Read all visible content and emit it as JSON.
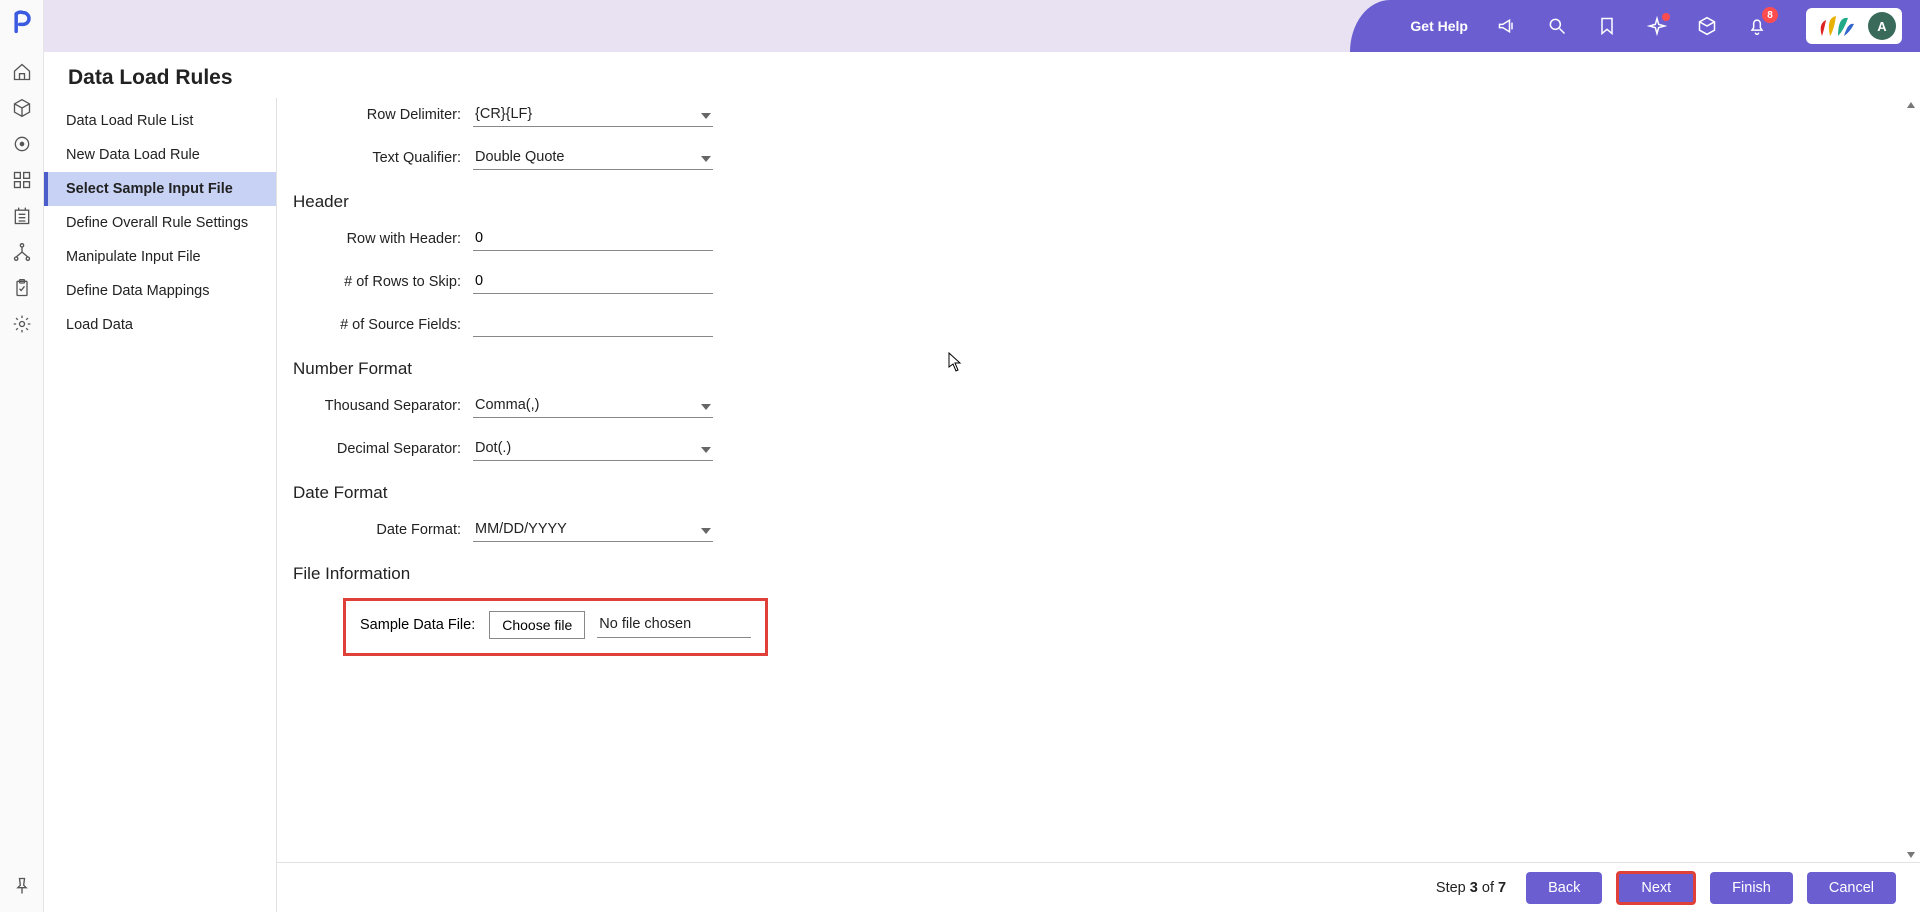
{
  "header": {
    "get_help": "Get Help",
    "badge_count": "8",
    "avatar_initial": "A"
  },
  "page_title": "Data Load Rules",
  "wizard": {
    "items": [
      "Data Load Rule List",
      "New Data Load Rule",
      "Select Sample Input File",
      "Define Overall Rule Settings",
      "Manipulate Input File",
      "Define Data Mappings",
      "Load Data"
    ],
    "active_index": 2
  },
  "form": {
    "row_delimiter_label": "Row Delimiter:",
    "row_delimiter_value": "{CR}{LF}",
    "text_qualifier_label": "Text Qualifier:",
    "text_qualifier_value": "Double Quote",
    "header_section": "Header",
    "row_with_header_label": "Row with Header:",
    "row_with_header_value": "0",
    "rows_to_skip_label": "# of Rows to Skip:",
    "rows_to_skip_value": "0",
    "source_fields_label": "# of Source Fields:",
    "source_fields_value": "",
    "number_section": "Number Format",
    "thousand_sep_label": "Thousand Separator:",
    "thousand_sep_value": "Comma(,)",
    "decimal_sep_label": "Decimal Separator:",
    "decimal_sep_value": "Dot(.)",
    "date_section": "Date Format",
    "date_format_label": "Date Format:",
    "date_format_value": "MM/DD/YYYY",
    "file_section": "File Information",
    "sample_file_label": "Sample Data File:",
    "choose_file_btn": "Choose file",
    "file_status": "No file chosen"
  },
  "footer": {
    "step_word": "Step",
    "step_current": "3",
    "step_of": "of",
    "step_total": "7",
    "back": "Back",
    "next": "Next",
    "finish": "Finish",
    "cancel": "Cancel"
  }
}
